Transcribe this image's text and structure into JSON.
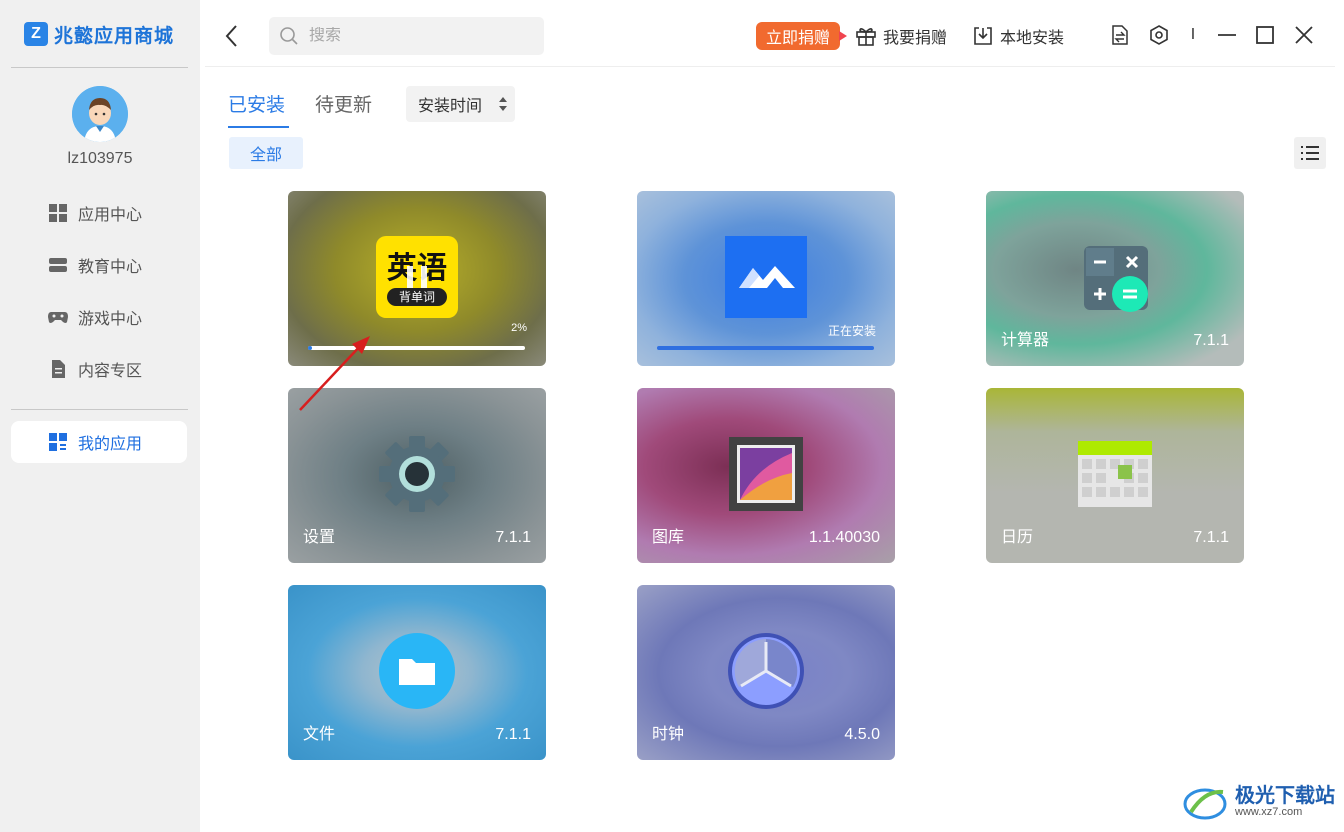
{
  "brand": {
    "name": "兆懿应用商城",
    "logo_char": "Z"
  },
  "user": {
    "name": "lz103975"
  },
  "nav": [
    {
      "label": "应用中心",
      "icon": "grid-icon"
    },
    {
      "label": "教育中心",
      "icon": "book-icon"
    },
    {
      "label": "游戏中心",
      "icon": "gamepad-icon"
    },
    {
      "label": "内容专区",
      "icon": "document-icon"
    },
    {
      "label": "我的应用",
      "icon": "my-apps-icon",
      "active": true
    }
  ],
  "search": {
    "placeholder": "搜索",
    "value": ""
  },
  "toolbar": {
    "donate_badge": "立即捐赠",
    "gift_label": "我要捐赠",
    "local_install_label": "本地安装",
    "separator": "I"
  },
  "tabs": [
    {
      "label": "已安装",
      "active": true
    },
    {
      "label": "待更新",
      "active": false
    }
  ],
  "sort": {
    "selected": "安装时间"
  },
  "filter": {
    "label": "全部"
  },
  "apps": [
    {
      "name": "",
      "version": "",
      "state": "paused",
      "icon_text_top": "英语",
      "icon_text_bottom": "背单词",
      "progress_label": "2%",
      "progress": 0.02
    },
    {
      "name": "",
      "version": "",
      "state": "installing",
      "status_label": "正在安装",
      "progress": 1.0
    },
    {
      "name": "计算器",
      "version": "7.1.1"
    },
    {
      "name": "设置",
      "version": "7.1.1"
    },
    {
      "name": "图库",
      "version": "1.1.40030"
    },
    {
      "name": "日历",
      "version": "7.1.1"
    },
    {
      "name": "文件",
      "version": "7.1.1"
    },
    {
      "name": "时钟",
      "version": "4.5.0"
    }
  ],
  "watermark": {
    "title": "极光下载站",
    "url": "www.xz7.com"
  },
  "colors": {
    "accent": "#2b7be5",
    "donate": "#f16a2f",
    "sidebar_bg": "#f0f0f0"
  }
}
